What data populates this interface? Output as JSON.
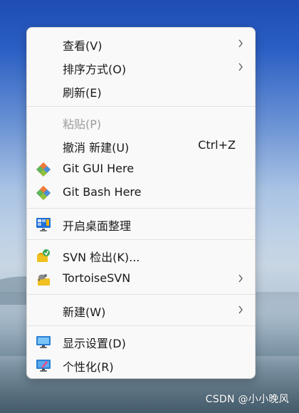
{
  "menu": {
    "items": [
      {
        "label": "查看(V)",
        "has_submenu": true
      },
      {
        "label": "排序方式(O)",
        "has_submenu": true
      },
      {
        "label": "刷新(E)"
      },
      {
        "label": "粘贴(P)",
        "disabled": true
      },
      {
        "label": "撤消 新建(U)",
        "shortcut": "Ctrl+Z"
      },
      {
        "label": "Git GUI Here",
        "icon": "git-icon"
      },
      {
        "label": "Git Bash Here",
        "icon": "git-icon"
      },
      {
        "label": "开启桌面整理",
        "icon": "desktop-organizer-icon"
      },
      {
        "label": "SVN 检出(K)...",
        "icon": "svn-checkout-icon"
      },
      {
        "label": "TortoiseSVN",
        "icon": "tortoisesvn-icon",
        "has_submenu": true
      },
      {
        "label": "新建(W)",
        "has_submenu": true
      },
      {
        "label": "显示设置(D)",
        "icon": "display-settings-icon"
      },
      {
        "label": "个性化(R)",
        "icon": "personalize-icon"
      }
    ]
  },
  "watermark": "CSDN @小小晚风",
  "colors": {
    "menu_bg": "#f9f9f9",
    "text": "#1a1a1a",
    "disabled_text": "#9d9d9d",
    "separator": "#e3e3e3",
    "git_red": "#e94e31",
    "git_green": "#5cb85c",
    "git_blue": "#4a90d9",
    "desktop_blue": "#1e6fd9"
  }
}
